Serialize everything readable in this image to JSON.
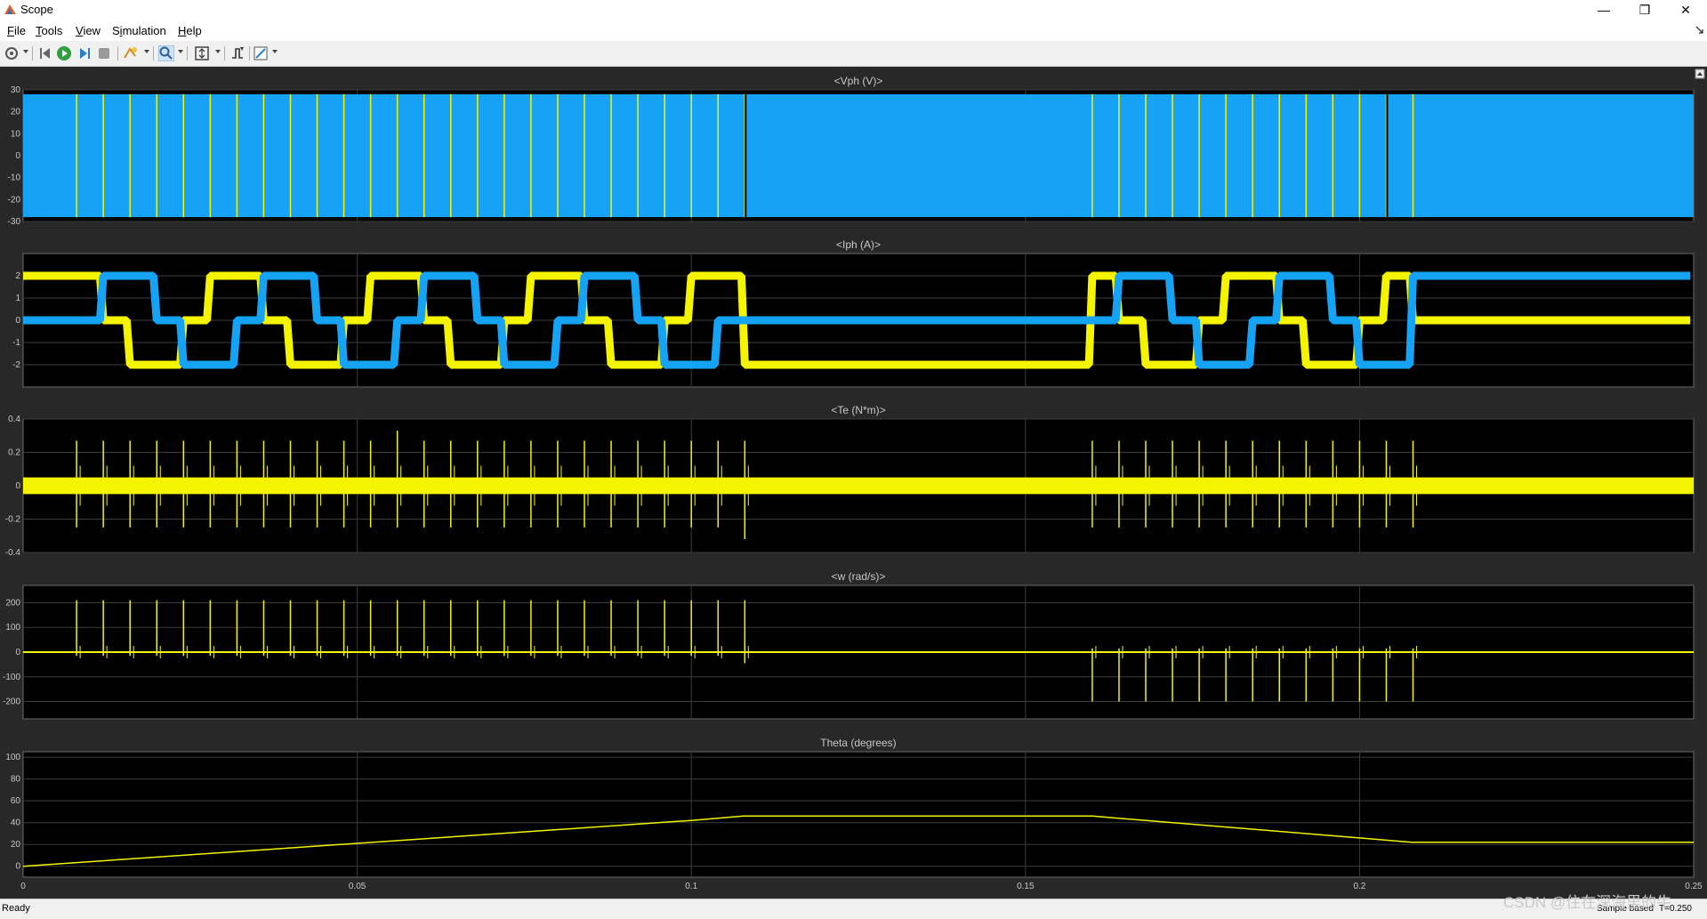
{
  "window": {
    "title": "Scope",
    "controls": {
      "minimize": "—",
      "restore": "❐",
      "close": "✕"
    }
  },
  "menu": [
    {
      "u": "F",
      "rest": "ile"
    },
    {
      "u": "T",
      "rest": "ools"
    },
    {
      "u": "V",
      "rest": "iew"
    },
    {
      "pre": "S",
      "u": "i",
      "rest": "mulation"
    },
    {
      "u": "H",
      "rest": "elp"
    }
  ],
  "toolbar": {
    "icons": [
      "settings-icon",
      "step-back-icon",
      "run-icon",
      "step-forward-icon",
      "stop-icon",
      "highlight-icon",
      "zoom-icon",
      "fit-axes-icon",
      "triggers-icon",
      "measure-icon"
    ]
  },
  "colors": {
    "plot_bg": "#000000",
    "area_bg": "#282828",
    "grid": "#3c3c3c",
    "axis_text": "#c8c8c8",
    "yellow": "#f4f400",
    "blue": "#16a3f6"
  },
  "status": {
    "ready": "Ready",
    "sample": "Sample based",
    "time": "T=0.250"
  },
  "watermark": "CSDN @住在深海里的牛",
  "chart_data": [
    {
      "type": "line",
      "title": "<Vph (V)>",
      "ylim": [
        -30,
        30
      ],
      "yticks": [
        "30",
        "20",
        "10",
        "0",
        "-10",
        "-20",
        "-30"
      ],
      "xlim": [
        0,
        0.25
      ],
      "grid": true,
      "series": [
        {
          "color": "#16a3f6",
          "kind": "pwm-band",
          "values": [
            28,
            -28
          ]
        },
        {
          "color": "#f4f400",
          "kind": "commutation-lines"
        }
      ]
    },
    {
      "type": "line",
      "title": "<Iph (A)>",
      "ylim": [
        -3,
        3
      ],
      "yticks": [
        "2",
        "1",
        "0",
        "-1",
        "-2"
      ],
      "xlim": [
        0,
        0.25
      ],
      "grid": true,
      "series": [
        {
          "color": "#f4f400",
          "kind": "trapezoid-phase"
        },
        {
          "color": "#16a3f6",
          "kind": "trapezoid-phase"
        }
      ]
    },
    {
      "type": "line",
      "title": "<Te (N*m)>",
      "ylim": [
        -0.4,
        0.4
      ],
      "yticks": [
        "0.4",
        "0.2",
        "0",
        "-0.2",
        "-0.4"
      ],
      "xlim": [
        0,
        0.25
      ],
      "grid": true,
      "series": [
        {
          "color": "#f4f400",
          "kind": "ripple-spikes",
          "band": [
            -0.05,
            0.05
          ],
          "spike": [
            0.27,
            -0.25
          ]
        }
      ]
    },
    {
      "type": "line",
      "title": "<w (rad/s)>",
      "ylim": [
        -270,
        270
      ],
      "yticks": [
        "200",
        "100",
        "0",
        "-100",
        "-200"
      ],
      "xlim": [
        0,
        0.25
      ],
      "grid": true,
      "series": [
        {
          "color": "#f4f400",
          "kind": "ripple-spikes",
          "spike_pos": 210,
          "spike_neg": -200
        }
      ]
    },
    {
      "type": "line",
      "title": "Theta (degrees)",
      "ylim": [
        -10,
        105
      ],
      "yticks": [
        "100",
        "80",
        "60",
        "40",
        "20",
        "0"
      ],
      "xlim": [
        0,
        0.25
      ],
      "xticks": [
        "0",
        "0.05",
        "0.1",
        "0.15",
        "0.2",
        "0.25"
      ],
      "grid": true,
      "series": [
        {
          "color": "#f4f400",
          "x": [
            0,
            0.1,
            0.1078,
            0.16,
            0.2,
            0.2078,
            0.25
          ],
          "values": [
            0,
            42,
            46,
            46,
            26,
            22,
            22
          ]
        }
      ]
    }
  ]
}
